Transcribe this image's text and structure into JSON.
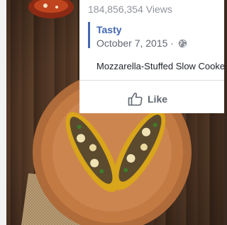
{
  "post": {
    "views": "184,856,354 Views",
    "author": "Tasty",
    "date": "October 7, 2015",
    "separator": "·",
    "privacy_icon": "globe-icon",
    "title": "Mozzarella-Stuffed Slow Cooker",
    "like_label": "Like",
    "like_icon": "thumbs-up-icon"
  },
  "thumbnail": {
    "subject": "stuffed-zucchini-boats-on-wooden-plate"
  },
  "colors": {
    "link": "#4267b2",
    "muted": "#90949c",
    "text": "#1d2129"
  }
}
